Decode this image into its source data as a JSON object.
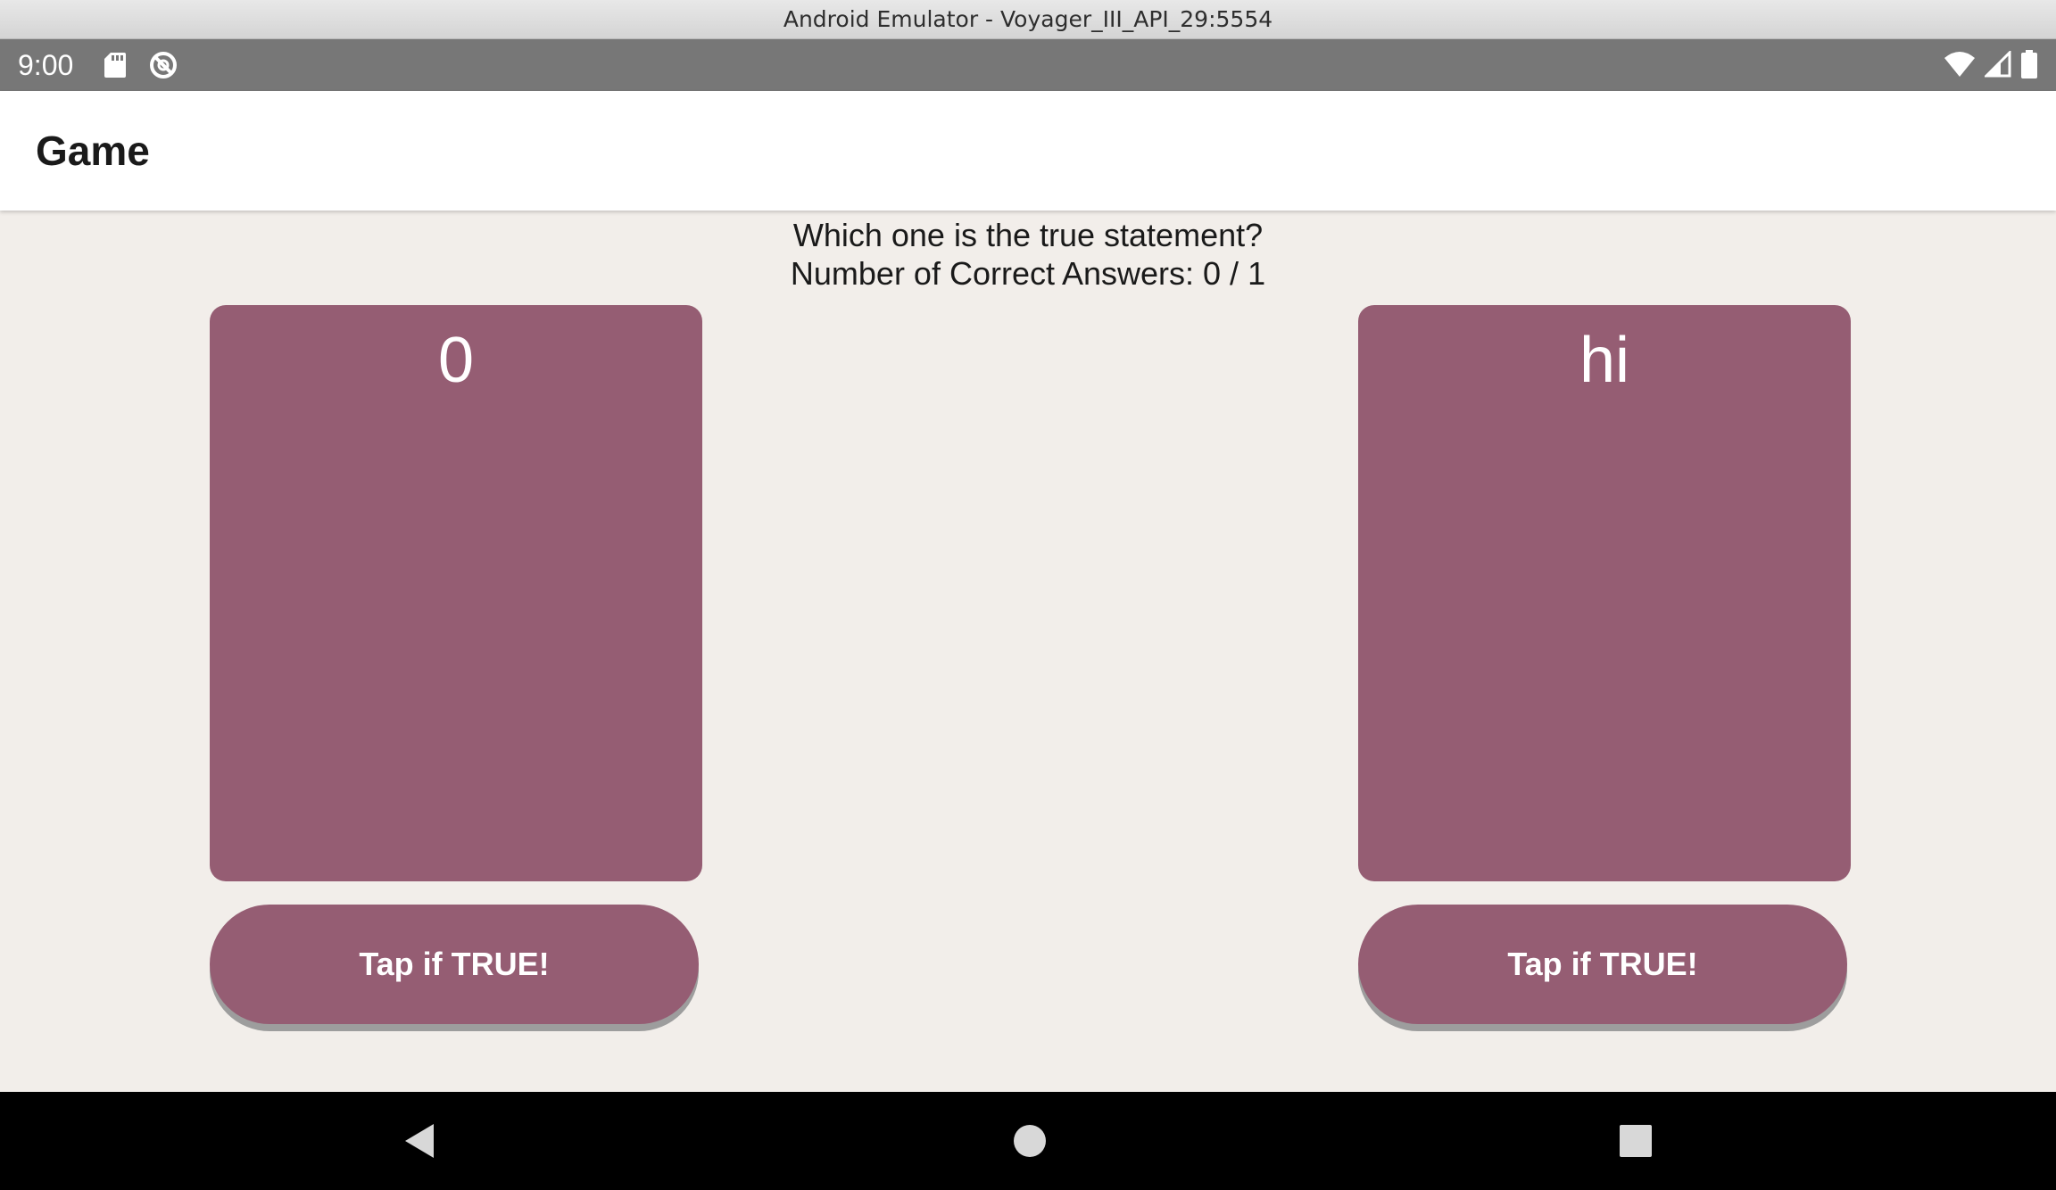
{
  "window": {
    "title": "Android Emulator - Voyager_III_API_29:5554"
  },
  "status_bar": {
    "time": "9:00",
    "left_icons": [
      "sd-card-icon",
      "sync-off-icon"
    ],
    "right_icons": [
      "wifi-icon",
      "cell-signal-icon",
      "battery-icon"
    ]
  },
  "app_bar": {
    "title": "Game"
  },
  "game": {
    "question": "Which one is the true statement?",
    "score": "Number of Correct Answers: 0 / 1",
    "cards": [
      {
        "text": "0",
        "button_label": "Tap if TRUE!"
      },
      {
        "text": "hi",
        "button_label": "Tap if TRUE!"
      }
    ]
  },
  "nav_bar": {
    "icons": [
      "back-icon",
      "home-icon",
      "recents-icon"
    ]
  },
  "colors": {
    "card": "#955d73",
    "background": "#f2eeea",
    "status_bar": "#777777",
    "nav_bar": "#000000"
  }
}
